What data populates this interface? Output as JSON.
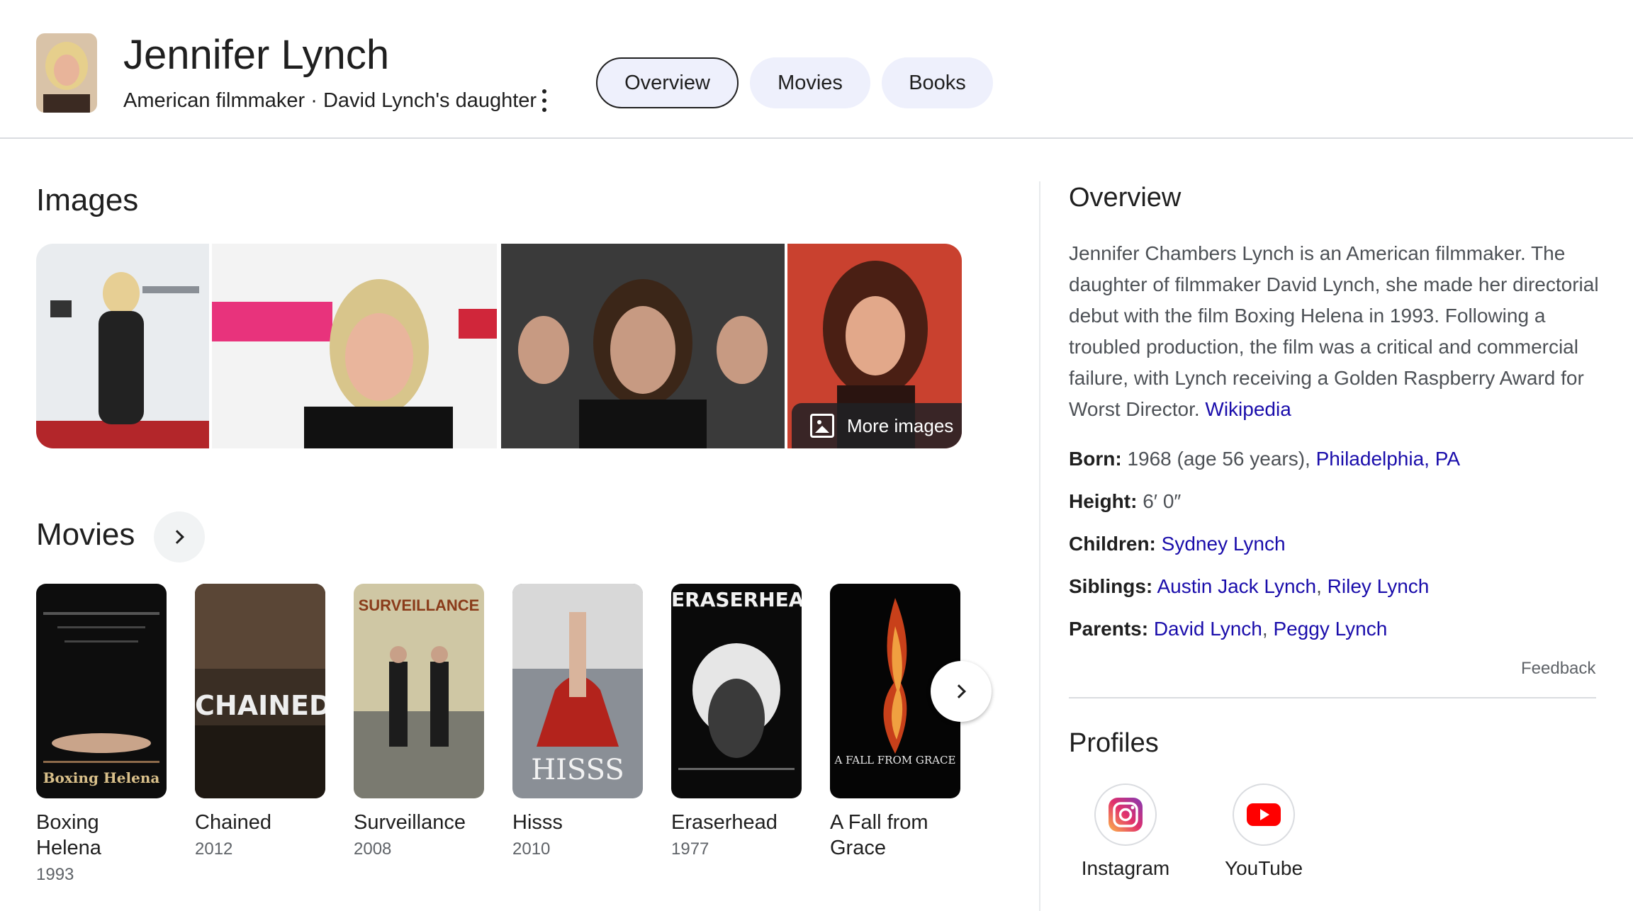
{
  "header": {
    "name": "Jennifer Lynch",
    "subtitle": "American filmmaker · David Lynch's daughter",
    "tabs": [
      {
        "label": "Overview",
        "active": true
      },
      {
        "label": "Movies",
        "active": false
      },
      {
        "label": "Books",
        "active": false
      }
    ]
  },
  "images": {
    "title": "Images",
    "more_label": "More images"
  },
  "movies": {
    "title": "Movies",
    "items": [
      {
        "title": "Boxing Helena",
        "year": "1993",
        "poster_text": "Boxing Helena"
      },
      {
        "title": "Chained",
        "year": "2012",
        "poster_text": "CHAINED"
      },
      {
        "title": "Surveillance",
        "year": "2008",
        "poster_text": "SURVEILLANCE"
      },
      {
        "title": "Hisss",
        "year": "2010",
        "poster_text": "HISSS"
      },
      {
        "title": "Eraserhead",
        "year": "1977",
        "poster_text": "ERASERHEAD"
      },
      {
        "title": "A Fall from Grace",
        "year": "",
        "poster_text": "A FALL FROM GRACE"
      }
    ]
  },
  "overview": {
    "title": "Overview",
    "description": "Jennifer Chambers Lynch is an American filmmaker. The daughter of filmmaker David Lynch, she made her directorial debut with the film Boxing Helena in 1993. Following a troubled production, the film was a critical and commercial failure, with Lynch receiving a Golden Raspberry Award for Worst Director.",
    "source_link": "Wikipedia",
    "facts": {
      "born_label": "Born:",
      "born_value": "1968 (age 56 years),",
      "born_link": "Philadelphia, PA",
      "height_label": "Height:",
      "height_value": "6′ 0″",
      "children_label": "Children:",
      "children_link": "Sydney Lynch",
      "siblings_label": "Siblings:",
      "siblings_link1": "Austin Jack Lynch",
      "siblings_link2": "Riley Lynch",
      "parents_label": "Parents:",
      "parents_link1": "David Lynch",
      "parents_link2": "Peggy Lynch"
    },
    "feedback": "Feedback"
  },
  "profiles": {
    "title": "Profiles",
    "items": [
      {
        "label": "Instagram",
        "icon": "instagram-icon"
      },
      {
        "label": "YouTube",
        "icon": "youtube-icon"
      }
    ]
  },
  "colors": {
    "link": "#1a0dab",
    "chip_bg": "#eef0fc",
    "youtube_red": "#ff0000"
  }
}
